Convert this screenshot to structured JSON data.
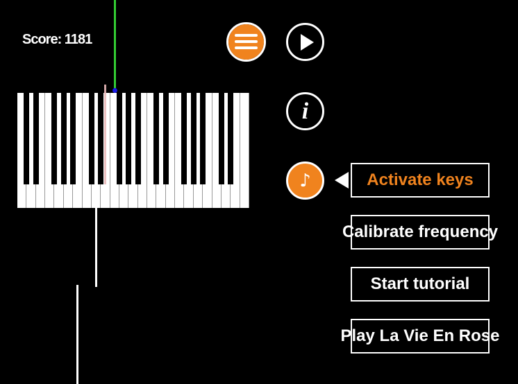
{
  "score": {
    "text": "Score: 1181"
  },
  "toolbar": {
    "hamburger_icon": "menu-icon",
    "play_icon": "play-icon",
    "info_icon": "info-icon",
    "info_glyph": "i",
    "music_icon": "music-note-icon",
    "music_glyph": "♪"
  },
  "menu": {
    "items": [
      {
        "label": "Activate keys",
        "active": true
      },
      {
        "label": "Calibrate frequency",
        "active": false
      },
      {
        "label": "Start tutorial",
        "active": false
      },
      {
        "label": "Play La Vie En Rose",
        "active": false
      }
    ]
  },
  "keyboard": {
    "white_keys": 25,
    "black_keys": 18
  },
  "colors": {
    "accent": "#F0831E",
    "background": "#000000",
    "foreground": "#FFFFFF",
    "green_line": "#33CC33",
    "blue_dot": "#1A1AE6",
    "pink_marker": "#E8B8B8"
  }
}
